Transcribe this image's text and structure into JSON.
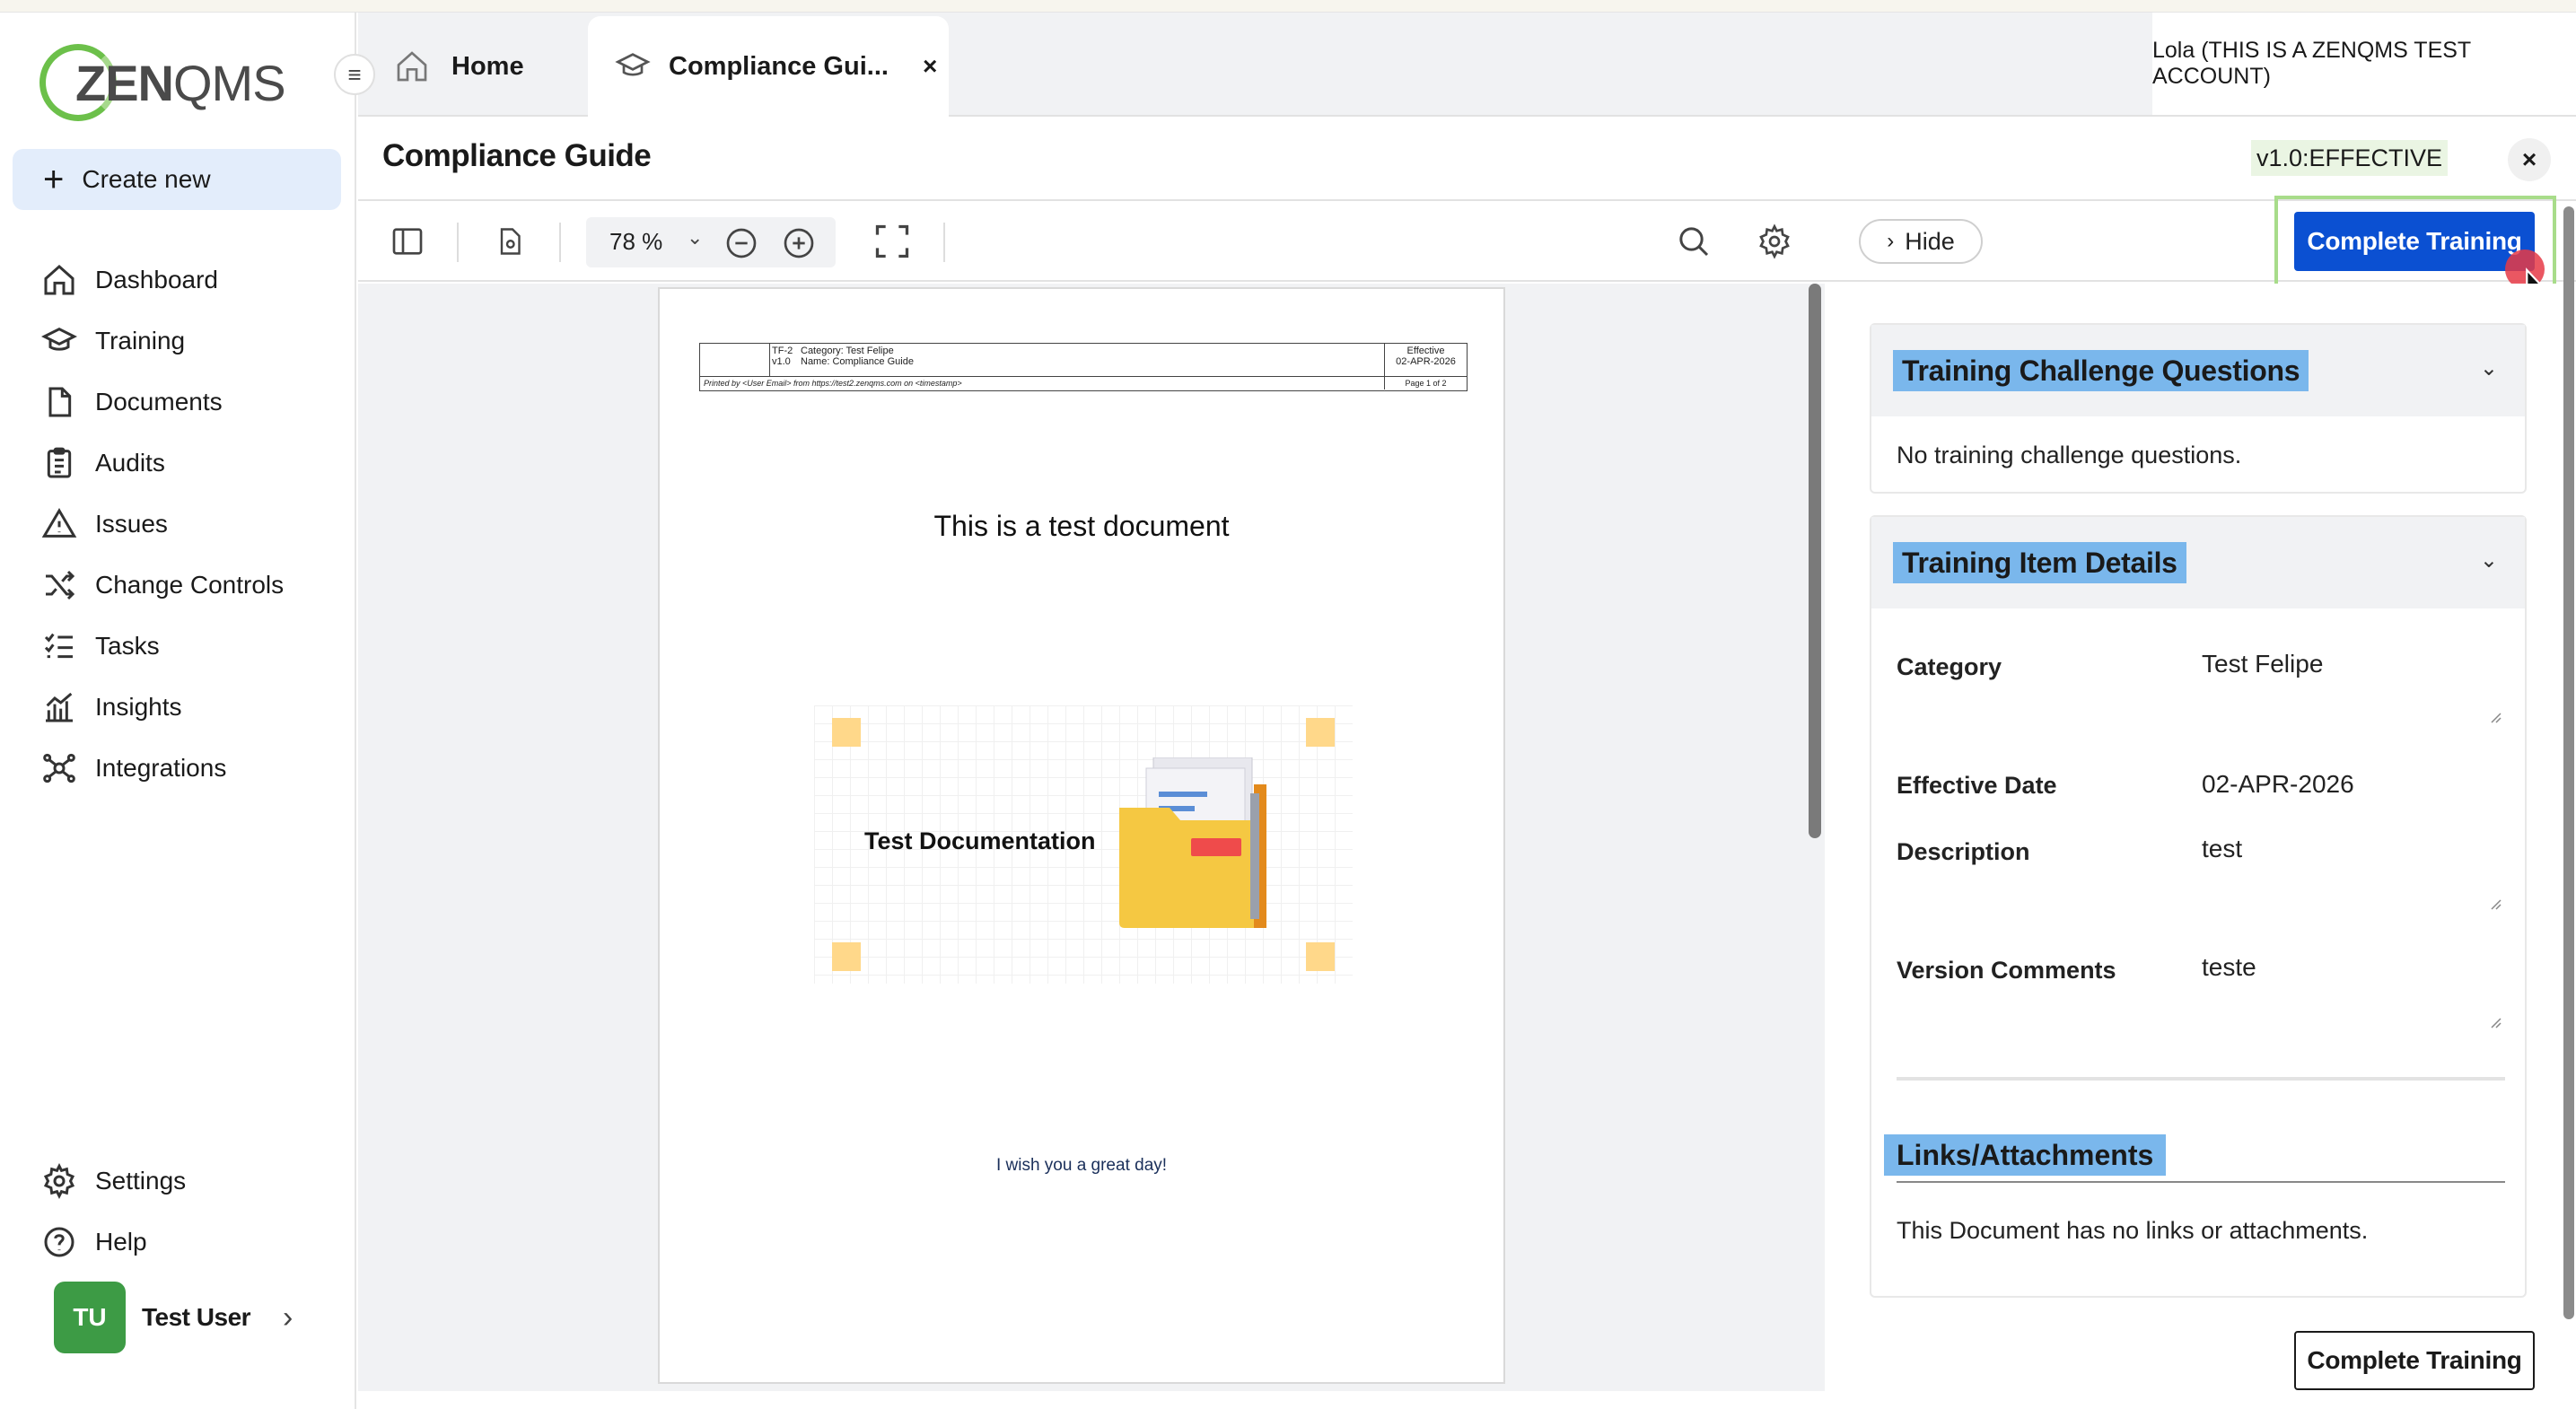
{
  "logo": {
    "part1": "ZEN",
    "part2": "QMS"
  },
  "sidebar": {
    "create_new": "Create new",
    "items": [
      {
        "label": "Dashboard",
        "icon": "home-icon"
      },
      {
        "label": "Training",
        "icon": "graduation-cap-icon"
      },
      {
        "label": "Documents",
        "icon": "document-icon"
      },
      {
        "label": "Audits",
        "icon": "clipboard-icon"
      },
      {
        "label": "Issues",
        "icon": "warning-icon"
      },
      {
        "label": "Change Controls",
        "icon": "shuffle-icon"
      },
      {
        "label": "Tasks",
        "icon": "checklist-icon"
      },
      {
        "label": "Insights",
        "icon": "chart-icon"
      },
      {
        "label": "Integrations",
        "icon": "network-icon"
      }
    ],
    "bottom_items": [
      {
        "label": "Settings",
        "icon": "gear-icon"
      },
      {
        "label": "Help",
        "icon": "help-icon"
      }
    ],
    "user": {
      "initials": "TU",
      "name": "Test User"
    }
  },
  "tabs": {
    "home": "Home",
    "active": "Compliance Gui...",
    "close": "×"
  },
  "account": "Lola (THIS IS A ZENQMS TEST ACCOUNT)",
  "header": {
    "title": "Compliance Guide",
    "status": "v1.0:EFFECTIVE"
  },
  "toolbar": {
    "zoom": "78 %",
    "hide": "Hide",
    "complete_training": "Complete Training"
  },
  "document": {
    "header": {
      "code": "TF-2",
      "version": "v1.0",
      "category": "Category: Test Felipe",
      "name": "Name: Compliance Guide",
      "effective_label": "Effective",
      "effective_date": "02-APR-2026",
      "printed_by": "Printed by <User Email> from https://test2.zenqms.com on <timestamp>",
      "page": "Page 1 of 2"
    },
    "title": "This is a test document",
    "illustration_label": "Test Documentation",
    "footer_text": "I wish you a great day!"
  },
  "panel": {
    "challenge": {
      "title": "Training Challenge Questions",
      "body": "No training challenge questions."
    },
    "details": {
      "title": "Training Item Details",
      "fields": [
        {
          "label": "Category",
          "value": "Test Felipe"
        },
        {
          "label": "Effective Date",
          "value": "02-APR-2026"
        },
        {
          "label": "Description",
          "value": "test"
        },
        {
          "label": "Version Comments",
          "value": "teste"
        }
      ]
    },
    "links": {
      "title": "Links/Attachments",
      "body": "This Document has no links or attachments."
    },
    "complete_training": "Complete Training"
  },
  "colors": {
    "primary": "#0b50d2",
    "highlight": "#7ab7ec",
    "logo_green": "#6cc04a",
    "avatar": "#3d9b45"
  }
}
